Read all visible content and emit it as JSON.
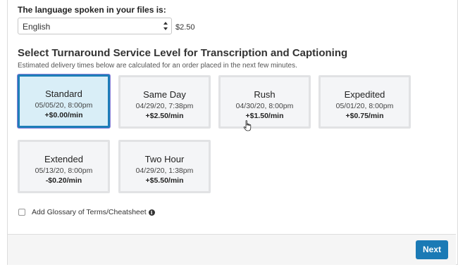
{
  "language": {
    "label": "The language spoken in your files is:",
    "selected": "English",
    "price": "$2.50"
  },
  "turnaround": {
    "title": "Select Turnaround Service Level for Transcription and Captioning",
    "subtitle": "Estimated delivery times below are calculated for an order placed in the next few minutes.",
    "options": [
      {
        "name": "Standard",
        "date": "05/05/20, 8:00pm",
        "price": "+$0.00/min",
        "selected": true
      },
      {
        "name": "Same Day",
        "date": "04/29/20, 7:38pm",
        "price": "+$2.50/min",
        "selected": false
      },
      {
        "name": "Rush",
        "date": "04/30/20, 8:00pm",
        "price": "+$1.50/min",
        "selected": false
      },
      {
        "name": "Expedited",
        "date": "05/01/20, 8:00pm",
        "price": "+$0.75/min",
        "selected": false
      },
      {
        "name": "Extended",
        "date": "05/13/20, 8:00pm",
        "price": "-$0.20/min",
        "selected": false
      },
      {
        "name": "Two Hour",
        "date": "04/29/20, 1:38pm",
        "price": "+$5.50/min",
        "selected": false
      }
    ]
  },
  "glossary": {
    "label": "Add Glossary of Terms/Cheatsheet",
    "checked": false
  },
  "footer": {
    "next_label": "Next"
  },
  "colors": {
    "accent": "#1b7ab5",
    "selected_bg": "#d9eef7"
  }
}
